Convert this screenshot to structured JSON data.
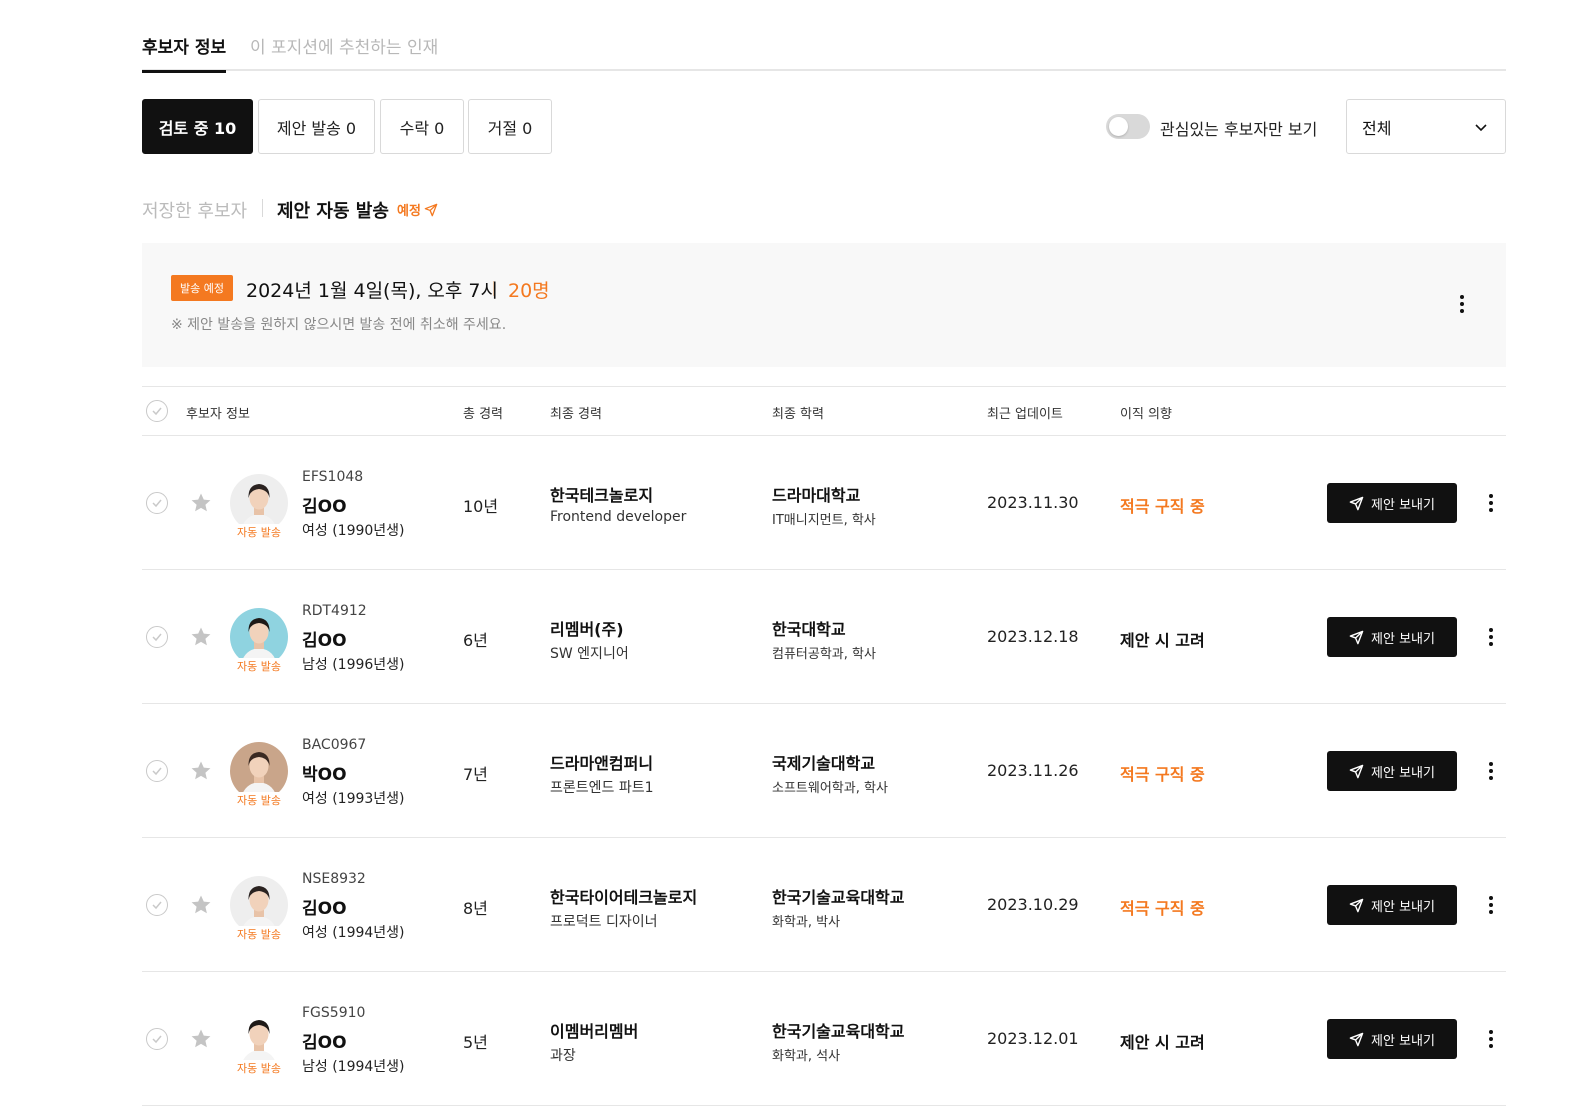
{
  "tabs": [
    {
      "label": "후보자 정보",
      "active": true
    },
    {
      "label": "이 포지션에 추천하는 인재",
      "active": false
    }
  ],
  "filters": [
    {
      "label": "검토 중 10",
      "active": true
    },
    {
      "label": "제안 발송 0",
      "active": false
    },
    {
      "label": "수락 0",
      "active": false
    },
    {
      "label": "거절 0",
      "active": false
    }
  ],
  "toggle": {
    "label": "관심있는 후보자만 보기",
    "on": false
  },
  "select": {
    "value": "전체"
  },
  "subtabs": {
    "saved": "저장한 후보자",
    "auto": "제안 자동 발송",
    "auto_badge": "예정"
  },
  "banner": {
    "badge": "발송 예정",
    "date": "2024년 1월 4일(목), 오후 7시",
    "count": "20명",
    "note": "※ 제안 발송을 원하지 않으시면 발송 전에 취소해 주세요."
  },
  "table": {
    "headers": {
      "candidate": "후보자 정보",
      "years": "총 경력",
      "last_career": "최종 경력",
      "education": "최종 학력",
      "updated": "최근 업데이트",
      "intent": "이직 의향"
    },
    "rows": [
      {
        "auto_tag": "자동 발송",
        "id": "EFS1048",
        "name": "김OO",
        "info": "여성 (1990년생)",
        "years": "10년",
        "company": "한국테크놀로지",
        "role": "Frontend developer",
        "school": "드라마대학교",
        "major": "IT매니지먼트, 학사",
        "updated": "2023.11.30",
        "intent": "적극 구직 중",
        "intent_color": "#f47920",
        "avatar_bg": "#eeeeee",
        "avatar_hair": "#2a2220",
        "send_label": "제안 보내기"
      },
      {
        "auto_tag": "자동 발송",
        "id": "RDT4912",
        "name": "김OO",
        "info": "남성 (1996년생)",
        "years": "6년",
        "company": "리멤버(주)",
        "role": "SW 엔지니어",
        "school": "한국대학교",
        "major": "컴퓨터공학과, 학사",
        "updated": "2023.12.18",
        "intent": "제안 시 고려",
        "intent_color": "#111111",
        "avatar_bg": "#8fd3e0",
        "avatar_hair": "#1e1a18",
        "send_label": "제안 보내기"
      },
      {
        "auto_tag": "자동 발송",
        "id": "BAC0967",
        "name": "박OO",
        "info": "여성 (1993년생)",
        "years": "7년",
        "company": "드라마앤컴퍼니",
        "role": "프론트엔드 파트1",
        "school": "국제기술대학교",
        "major": "소프트웨어학과, 학사",
        "updated": "2023.11.26",
        "intent": "적극 구직 중",
        "intent_color": "#f47920",
        "avatar_bg": "#c9a58a",
        "avatar_hair": "#3a2a22",
        "send_label": "제안 보내기"
      },
      {
        "auto_tag": "자동 발송",
        "id": "NSE8932",
        "name": "김OO",
        "info": "여성 (1994년생)",
        "years": "8년",
        "company": "한국타이어테크놀로지",
        "role": "프로덕트 디자이너",
        "school": "한국기술교육대학교",
        "major": "화학과, 박사",
        "updated": "2023.10.29",
        "intent": "적극 구직 중",
        "intent_color": "#f47920",
        "avatar_bg": "#eeeeee",
        "avatar_hair": "#2a2220",
        "send_label": "제안 보내기"
      },
      {
        "auto_tag": "자동 발송",
        "id": "FGS5910",
        "name": "김OO",
        "info": "남성 (1994년생)",
        "years": "5년",
        "company": "이멤버리멤버",
        "role": "과장",
        "school": "한국기술교육대학교",
        "major": "화학과, 석사",
        "updated": "2023.12.01",
        "intent": "제안 시 고려",
        "intent_color": "#111111",
        "avatar_bg": "#ffffff",
        "avatar_hair": "#1e1a18",
        "send_label": "제안 보내기"
      }
    ]
  },
  "colors": {
    "accent": "#f47920",
    "primary": "#111111",
    "divider": "#e6e6e6"
  },
  "icons": [
    "check-circle-icon",
    "star-icon",
    "paper-plane-icon",
    "kebab-menu-icon",
    "chevron-down-icon"
  ]
}
